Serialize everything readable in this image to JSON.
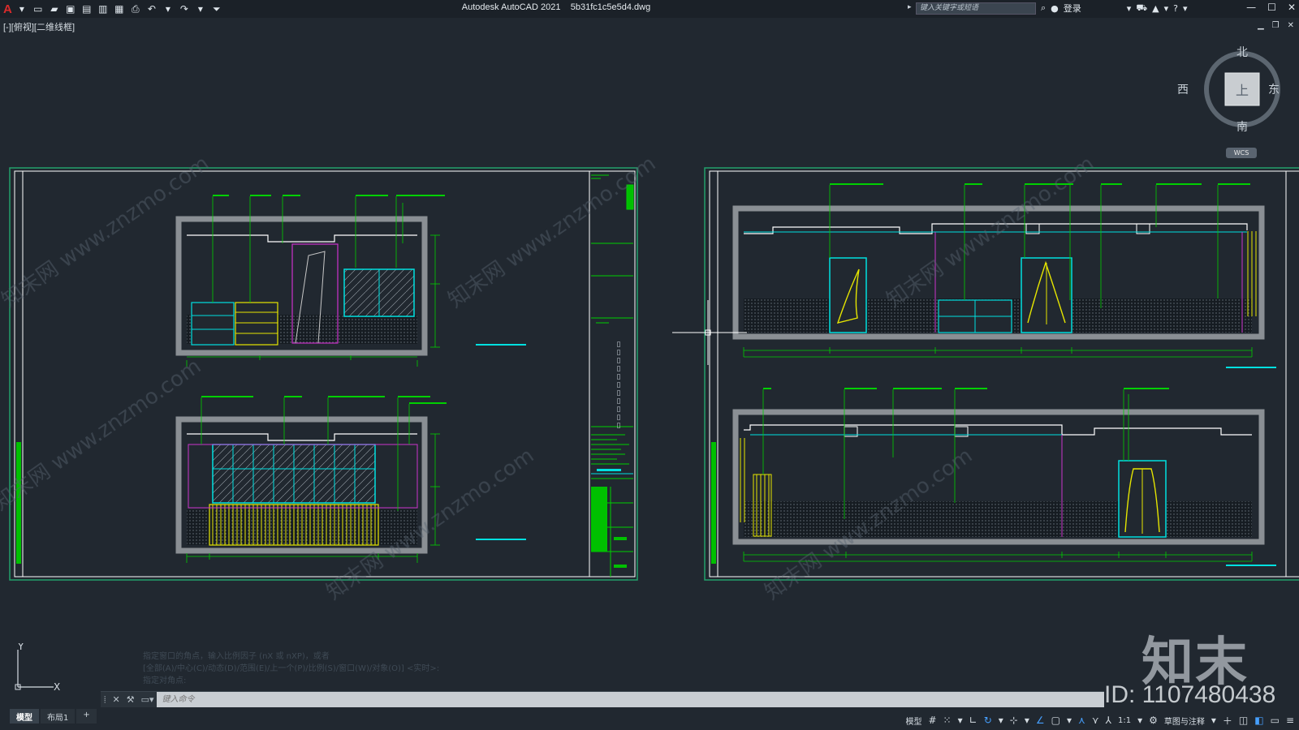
{
  "app": {
    "logo": "A",
    "title": "Autodesk AutoCAD 2021",
    "filename": "5b31fc1c5e5d4.dwg"
  },
  "toolbar": {
    "search_placeholder": "键入关键字或短语",
    "login_label": "登录"
  },
  "viewport": {
    "label": "[-][俯视][二维线框]"
  },
  "navcube": {
    "north": "北",
    "south": "南",
    "east": "东",
    "west": "西",
    "face": "上",
    "wcs": "WCS"
  },
  "command": {
    "history": [
      "指定窗口的角点，输入比例因子 (nX 或 nXP)，或者",
      "[全部(A)/中心(C)/动态(D)/范围(E)/上一个(P)/比例(S)/窗口(W)/对象(O)] <实时>:",
      "指定对角点:"
    ],
    "placeholder": "键入命令"
  },
  "layout_tabs": [
    "模型",
    "布局1",
    "+"
  ],
  "statusbar": {
    "model_label": "模型",
    "scale": "1:1",
    "workspace": "草图与注释"
  },
  "ucs": {
    "x": "X",
    "y": "Y"
  },
  "watermark": {
    "logo": "知末",
    "id": "ID: 1107480438",
    "diagonal": "知末网 www.znzmo.com"
  },
  "colors": {
    "background": "#212830",
    "frame": "#ffffff",
    "leader": "#00d000",
    "cyan": "#00e0e0",
    "yellow": "#e6e600",
    "magenta": "#cc33cc",
    "wall": "#8a8f94"
  }
}
